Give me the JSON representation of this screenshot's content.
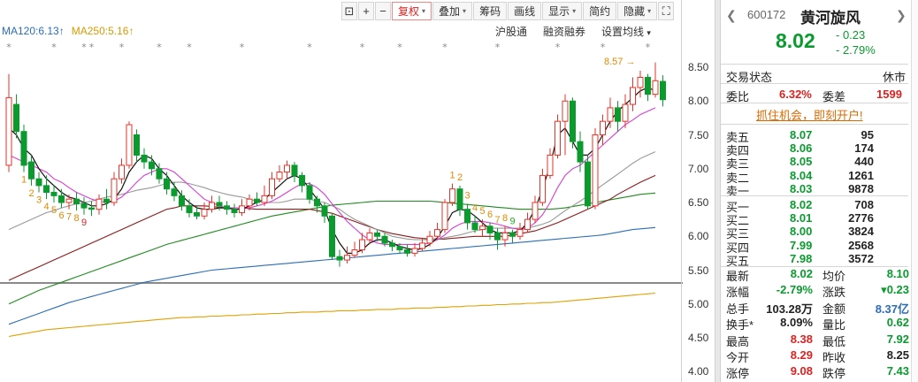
{
  "toolbar": {
    "icon_lock": "⊡",
    "icon_plus": "+",
    "icon_minus": "−",
    "fuquan": "复权",
    "diejia": "叠加",
    "chouma": "筹码",
    "huaxian": "画线",
    "xianshi": "显示",
    "jianyue": "简约",
    "yincang": "隐藏",
    "caret": "▾",
    "fullscreen_icon": "⛶"
  },
  "ma_legend": {
    "ma120": "MA120:6.13",
    "ma120_arrow": "↑",
    "ma250": "MA250:5.16",
    "ma250_arrow": "↑"
  },
  "sub_toolbar": {
    "hugutong": "沪股通",
    "rongzi": "融资融券",
    "shezhi": "设置均线",
    "caret": "▾"
  },
  "chart_data": {
    "type": "candlestick",
    "ylim": [
      4.0,
      8.5
    ],
    "y_ticks": [
      "8.50",
      "8.00",
      "7.50",
      "7.00",
      "6.50",
      "6.00",
      "5.50",
      "5.00",
      "4.50",
      "4.00"
    ],
    "high_label": "8.57",
    "high_arrow": "→",
    "candles": [
      {
        "o": 7.05,
        "c": 8.05,
        "h": 8.4,
        "l": 6.95
      },
      {
        "o": 7.95,
        "c": 7.55,
        "h": 8.1,
        "l": 7.45
      },
      {
        "o": 7.55,
        "c": 7.05,
        "h": 7.65,
        "l": 6.95
      },
      {
        "o": 7.1,
        "c": 6.85,
        "h": 7.2,
        "l": 6.75
      },
      {
        "o": 6.85,
        "c": 6.75,
        "h": 6.95,
        "l": 6.65
      },
      {
        "o": 6.75,
        "c": 6.65,
        "h": 6.9,
        "l": 6.55
      },
      {
        "o": 6.65,
        "c": 6.6,
        "h": 6.75,
        "l": 6.5
      },
      {
        "o": 6.6,
        "c": 6.5,
        "h": 6.7,
        "l": 6.42
      },
      {
        "o": 6.5,
        "c": 6.55,
        "h": 6.62,
        "l": 6.4
      },
      {
        "o": 6.55,
        "c": 6.48,
        "h": 6.65,
        "l": 6.38
      },
      {
        "o": 6.48,
        "c": 6.42,
        "h": 6.58,
        "l": 6.32
      },
      {
        "o": 6.42,
        "c": 6.4,
        "h": 6.52,
        "l": 6.3
      },
      {
        "o": 6.4,
        "c": 6.55,
        "h": 6.62,
        "l": 6.32
      },
      {
        "o": 6.55,
        "c": 6.5,
        "h": 6.7,
        "l": 6.4
      },
      {
        "o": 6.5,
        "c": 6.85,
        "h": 6.95,
        "l": 6.45
      },
      {
        "o": 6.85,
        "c": 7.05,
        "h": 7.15,
        "l": 6.78
      },
      {
        "o": 7.05,
        "c": 7.65,
        "h": 7.7,
        "l": 7.0
      },
      {
        "o": 7.5,
        "c": 7.2,
        "h": 7.58,
        "l": 7.1
      },
      {
        "o": 7.2,
        "c": 7.1,
        "h": 7.3,
        "l": 7.0
      },
      {
        "o": 7.1,
        "c": 7.0,
        "h": 7.2,
        "l": 6.9
      },
      {
        "o": 7.0,
        "c": 6.85,
        "h": 7.08,
        "l": 6.78
      },
      {
        "o": 6.85,
        "c": 6.7,
        "h": 6.95,
        "l": 6.62
      },
      {
        "o": 6.7,
        "c": 6.6,
        "h": 6.8,
        "l": 6.52
      },
      {
        "o": 6.6,
        "c": 6.45,
        "h": 6.68,
        "l": 6.38
      },
      {
        "o": 6.45,
        "c": 6.35,
        "h": 6.55,
        "l": 6.28
      },
      {
        "o": 6.35,
        "c": 6.3,
        "h": 6.45,
        "l": 6.25
      },
      {
        "o": 6.3,
        "c": 6.4,
        "h": 6.5,
        "l": 6.25
      },
      {
        "o": 6.4,
        "c": 6.5,
        "h": 6.6,
        "l": 6.35
      },
      {
        "o": 6.5,
        "c": 6.45,
        "h": 6.6,
        "l": 6.38
      },
      {
        "o": 6.45,
        "c": 6.4,
        "h": 6.52,
        "l": 6.32
      },
      {
        "o": 6.4,
        "c": 6.35,
        "h": 6.48,
        "l": 6.28
      },
      {
        "o": 6.35,
        "c": 6.45,
        "h": 6.55,
        "l": 6.3
      },
      {
        "o": 6.45,
        "c": 6.55,
        "h": 6.62,
        "l": 6.38
      },
      {
        "o": 6.55,
        "c": 6.5,
        "h": 6.65,
        "l": 6.45
      },
      {
        "o": 6.5,
        "c": 6.6,
        "h": 6.75,
        "l": 6.45
      },
      {
        "o": 6.6,
        "c": 6.85,
        "h": 6.95,
        "l": 6.55
      },
      {
        "o": 6.85,
        "c": 6.95,
        "h": 7.05,
        "l": 6.8
      },
      {
        "o": 6.95,
        "c": 7.05,
        "h": 7.12,
        "l": 6.85
      },
      {
        "o": 7.05,
        "c": 6.9,
        "h": 7.1,
        "l": 6.8
      },
      {
        "o": 6.9,
        "c": 6.75,
        "h": 6.95,
        "l": 6.65
      },
      {
        "o": 6.75,
        "c": 6.55,
        "h": 6.8,
        "l": 6.48
      },
      {
        "o": 6.55,
        "c": 6.45,
        "h": 6.6,
        "l": 6.35
      },
      {
        "o": 6.45,
        "c": 6.3,
        "h": 6.5,
        "l": 6.2
      },
      {
        "o": 6.3,
        "c": 5.7,
        "h": 6.35,
        "l": 5.65
      },
      {
        "o": 5.7,
        "c": 5.65,
        "h": 5.8,
        "l": 5.55
      },
      {
        "o": 5.65,
        "c": 5.72,
        "h": 5.85,
        "l": 5.6
      },
      {
        "o": 5.72,
        "c": 5.8,
        "h": 5.92,
        "l": 5.68
      },
      {
        "o": 5.8,
        "c": 5.95,
        "h": 6.05,
        "l": 5.75
      },
      {
        "o": 5.95,
        "c": 6.05,
        "h": 6.12,
        "l": 5.88
      },
      {
        "o": 6.05,
        "c": 6.0,
        "h": 6.1,
        "l": 5.92
      },
      {
        "o": 6.0,
        "c": 5.9,
        "h": 6.05,
        "l": 5.85
      },
      {
        "o": 5.9,
        "c": 5.85,
        "h": 5.95,
        "l": 5.78
      },
      {
        "o": 5.85,
        "c": 5.8,
        "h": 5.9,
        "l": 5.75
      },
      {
        "o": 5.8,
        "c": 5.75,
        "h": 5.88,
        "l": 5.7
      },
      {
        "o": 5.75,
        "c": 5.82,
        "h": 5.9,
        "l": 5.7
      },
      {
        "o": 5.82,
        "c": 5.9,
        "h": 5.98,
        "l": 5.78
      },
      {
        "o": 5.9,
        "c": 6.0,
        "h": 6.08,
        "l": 5.85
      },
      {
        "o": 6.0,
        "c": 6.1,
        "h": 6.2,
        "l": 5.95
      },
      {
        "o": 6.1,
        "c": 6.5,
        "h": 6.55,
        "l": 6.05
      },
      {
        "o": 6.5,
        "c": 6.7,
        "h": 6.78,
        "l": 6.45
      },
      {
        "o": 6.7,
        "c": 6.4,
        "h": 6.75,
        "l": 6.3
      },
      {
        "o": 6.4,
        "c": 6.2,
        "h": 6.48,
        "l": 6.1
      },
      {
        "o": 6.2,
        "c": 6.1,
        "h": 6.3,
        "l": 6.05
      },
      {
        "o": 6.1,
        "c": 6.15,
        "h": 6.25,
        "l": 6.0
      },
      {
        "o": 6.15,
        "c": 6.05,
        "h": 6.2,
        "l": 5.95
      },
      {
        "o": 6.05,
        "c": 5.95,
        "h": 6.12,
        "l": 5.8
      },
      {
        "o": 5.95,
        "c": 6.05,
        "h": 6.15,
        "l": 5.85
      },
      {
        "o": 6.05,
        "c": 6.0,
        "h": 6.1,
        "l": 5.9
      },
      {
        "o": 6.0,
        "c": 6.1,
        "h": 6.2,
        "l": 5.95
      },
      {
        "o": 6.1,
        "c": 6.25,
        "h": 6.35,
        "l": 6.05
      },
      {
        "o": 6.25,
        "c": 6.5,
        "h": 6.6,
        "l": 6.2
      },
      {
        "o": 6.5,
        "c": 6.9,
        "h": 7.0,
        "l": 6.45
      },
      {
        "o": 6.9,
        "c": 7.2,
        "h": 7.3,
        "l": 6.85
      },
      {
        "o": 7.2,
        "c": 7.7,
        "h": 7.8,
        "l": 7.15
      },
      {
        "o": 7.7,
        "c": 8.0,
        "h": 8.1,
        "l": 7.2
      },
      {
        "o": 8.0,
        "c": 7.4,
        "h": 8.05,
        "l": 7.3
      },
      {
        "o": 7.4,
        "c": 7.1,
        "h": 7.55,
        "l": 6.95
      },
      {
        "o": 7.1,
        "c": 6.45,
        "h": 7.2,
        "l": 6.4
      },
      {
        "o": 6.45,
        "c": 7.5,
        "h": 7.6,
        "l": 6.4
      },
      {
        "o": 7.5,
        "c": 7.7,
        "h": 7.8,
        "l": 7.35
      },
      {
        "o": 7.7,
        "c": 7.9,
        "h": 8.05,
        "l": 7.6
      },
      {
        "o": 7.9,
        "c": 7.7,
        "h": 8.0,
        "l": 7.55
      },
      {
        "o": 7.7,
        "c": 7.95,
        "h": 8.1,
        "l": 7.6
      },
      {
        "o": 7.95,
        "c": 8.2,
        "h": 8.35,
        "l": 7.85
      },
      {
        "o": 8.2,
        "c": 8.35,
        "h": 8.45,
        "l": 8.05
      },
      {
        "o": 8.35,
        "c": 8.1,
        "h": 8.4,
        "l": 8.0
      },
      {
        "o": 8.1,
        "c": 8.3,
        "h": 8.57,
        "l": 8.05
      },
      {
        "o": 8.29,
        "c": 8.02,
        "h": 8.38,
        "l": 7.92
      }
    ],
    "ma5": [
      7.6,
      7.5,
      7.3,
      7.2,
      7.0,
      6.85,
      6.75,
      6.65,
      6.58,
      6.55,
      6.5,
      6.45,
      6.45,
      6.48,
      6.55,
      6.7,
      6.95,
      7.1,
      7.2,
      7.15,
      7.0,
      6.9,
      6.75,
      6.6,
      6.5,
      6.42,
      6.4,
      6.4,
      6.42,
      6.42,
      6.4,
      6.4,
      6.45,
      6.5,
      6.55,
      6.65,
      6.75,
      6.85,
      6.9,
      6.85,
      6.7,
      6.55,
      6.4,
      6.1,
      5.9,
      5.75,
      5.75,
      5.8,
      5.9,
      5.95,
      5.95,
      5.9,
      5.85,
      5.82,
      5.8,
      5.82,
      5.88,
      5.98,
      6.15,
      6.35,
      6.4,
      6.38,
      6.3,
      6.2,
      6.1,
      6.05,
      6.05,
      6.05,
      6.08,
      6.2,
      6.4,
      6.7,
      7.05,
      7.5,
      7.6,
      7.4,
      7.2,
      7.2,
      7.3,
      7.5,
      7.7,
      7.85,
      7.95,
      8.05,
      8.15,
      8.2,
      8.15
    ],
    "ma10": [
      7.2,
      7.15,
      7.1,
      7.05,
      7.0,
      6.95,
      6.85,
      6.8,
      6.72,
      6.65,
      6.6,
      6.55,
      6.52,
      6.5,
      6.52,
      6.58,
      6.68,
      6.8,
      6.9,
      6.95,
      7.0,
      7.0,
      6.95,
      6.85,
      6.75,
      6.65,
      6.55,
      6.5,
      6.45,
      6.42,
      6.42,
      6.42,
      6.42,
      6.45,
      6.48,
      6.52,
      6.58,
      6.65,
      6.72,
      6.78,
      6.78,
      6.72,
      6.62,
      6.48,
      6.35,
      6.22,
      6.12,
      6.02,
      5.95,
      5.9,
      5.88,
      5.88,
      5.88,
      5.88,
      5.88,
      5.88,
      5.9,
      5.95,
      6.02,
      6.12,
      6.18,
      6.22,
      6.22,
      6.22,
      6.2,
      6.18,
      6.15,
      6.12,
      6.1,
      6.12,
      6.2,
      6.32,
      6.5,
      6.72,
      6.9,
      7.0,
      7.05,
      7.15,
      7.25,
      7.35,
      7.45,
      7.55,
      7.65,
      7.72,
      7.8,
      7.85,
      7.9
    ],
    "ma20": [
      6.1,
      6.15,
      6.2,
      6.25,
      6.3,
      6.35,
      6.38,
      6.42,
      6.45,
      6.48,
      6.5,
      6.52,
      6.55,
      6.58,
      6.6,
      6.62,
      6.65,
      6.68,
      6.7,
      6.72,
      6.75,
      6.78,
      6.8,
      6.8,
      6.78,
      6.75,
      6.72,
      6.68,
      6.65,
      6.62,
      6.6,
      6.58,
      6.55,
      6.52,
      6.5,
      6.5,
      6.5,
      6.52,
      6.55,
      6.55,
      6.55,
      6.52,
      6.5,
      6.45,
      6.4,
      6.32,
      6.25,
      6.2,
      6.15,
      6.1,
      6.05,
      6.0,
      5.98,
      5.96,
      5.95,
      5.95,
      5.95,
      5.96,
      5.98,
      6.0,
      6.02,
      6.05,
      6.08,
      6.1,
      6.12,
      6.12,
      6.12,
      6.12,
      6.12,
      6.12,
      6.15,
      6.18,
      6.22,
      6.3,
      6.38,
      6.45,
      6.52,
      6.6,
      6.68,
      6.76,
      6.84,
      6.92,
      7.0,
      7.08,
      7.15,
      7.2,
      7.25
    ],
    "ma30": [
      5.35,
      5.4,
      5.45,
      5.5,
      5.55,
      5.6,
      5.65,
      5.7,
      5.75,
      5.8,
      5.85,
      5.9,
      5.95,
      6.0,
      6.05,
      6.1,
      6.15,
      6.2,
      6.25,
      6.3,
      6.35,
      6.4,
      6.42,
      6.45,
      6.45,
      6.45,
      6.45,
      6.44,
      6.43,
      6.42,
      6.42,
      6.42,
      6.41,
      6.4,
      6.4,
      6.4,
      6.4,
      6.4,
      6.4,
      6.4,
      6.4,
      6.38,
      6.36,
      6.34,
      6.3,
      6.26,
      6.22,
      6.18,
      6.14,
      6.1,
      6.07,
      6.04,
      6.02,
      6.0,
      5.98,
      5.97,
      5.96,
      5.96,
      5.96,
      5.97,
      5.98,
      5.99,
      6.0,
      6.0,
      6.0,
      6.0,
      6.0,
      6.02,
      6.04,
      6.06,
      6.08,
      6.12,
      6.16,
      6.2,
      6.25,
      6.3,
      6.35,
      6.4,
      6.45,
      6.5,
      6.55,
      6.62,
      6.68,
      6.74,
      6.8,
      6.85,
      6.9
    ],
    "ma60": [
      5.0,
      5.05,
      5.1,
      5.15,
      5.2,
      5.24,
      5.28,
      5.32,
      5.36,
      5.4,
      5.44,
      5.48,
      5.52,
      5.56,
      5.6,
      5.64,
      5.68,
      5.72,
      5.76,
      5.8,
      5.84,
      5.88,
      5.91,
      5.94,
      5.97,
      6.0,
      6.03,
      6.06,
      6.09,
      6.12,
      6.15,
      6.18,
      6.21,
      6.24,
      6.27,
      6.3,
      6.32,
      6.34,
      6.36,
      6.38,
      6.4,
      6.42,
      6.44,
      6.46,
      6.47,
      6.48,
      6.49,
      6.5,
      6.51,
      6.52,
      6.52,
      6.52,
      6.52,
      6.52,
      6.52,
      6.52,
      6.52,
      6.51,
      6.5,
      6.49,
      6.48,
      6.47,
      6.46,
      6.45,
      6.44,
      6.43,
      6.42,
      6.41,
      6.4,
      6.4,
      6.4,
      6.4,
      6.4,
      6.41,
      6.42,
      6.44,
      6.46,
      6.48,
      6.5,
      6.52,
      6.54,
      6.56,
      6.58,
      6.6,
      6.62,
      6.63,
      6.64
    ],
    "ma120": [
      4.7,
      4.74,
      4.78,
      4.82,
      4.86,
      4.9,
      4.94,
      4.98,
      5.02,
      5.05,
      5.08,
      5.11,
      5.14,
      5.17,
      5.2,
      5.23,
      5.26,
      5.29,
      5.32,
      5.34,
      5.36,
      5.38,
      5.4,
      5.42,
      5.44,
      5.46,
      5.48,
      5.5,
      5.51,
      5.52,
      5.53,
      5.54,
      5.55,
      5.56,
      5.57,
      5.58,
      5.59,
      5.6,
      5.61,
      5.62,
      5.63,
      5.64,
      5.65,
      5.66,
      5.67,
      5.68,
      5.69,
      5.7,
      5.71,
      5.72,
      5.73,
      5.74,
      5.75,
      5.76,
      5.77,
      5.78,
      5.79,
      5.8,
      5.81,
      5.82,
      5.83,
      5.84,
      5.85,
      5.86,
      5.87,
      5.88,
      5.89,
      5.9,
      5.91,
      5.92,
      5.93,
      5.94,
      5.95,
      5.96,
      5.97,
      5.98,
      5.99,
      6.0,
      6.01,
      6.02,
      6.04,
      6.06,
      6.08,
      6.1,
      6.11,
      6.12,
      6.13
    ],
    "ma250": [
      4.52,
      4.54,
      4.56,
      4.58,
      4.6,
      4.62,
      4.63,
      4.64,
      4.65,
      4.66,
      4.67,
      4.68,
      4.69,
      4.7,
      4.71,
      4.72,
      4.73,
      4.74,
      4.75,
      4.76,
      4.77,
      4.78,
      4.79,
      4.8,
      4.8,
      4.81,
      4.81,
      4.82,
      4.82,
      4.83,
      4.83,
      4.84,
      4.84,
      4.85,
      4.85,
      4.86,
      4.86,
      4.87,
      4.87,
      4.88,
      4.88,
      4.88,
      4.89,
      4.89,
      4.9,
      4.9,
      4.9,
      4.91,
      4.91,
      4.92,
      4.92,
      4.92,
      4.93,
      4.93,
      4.94,
      4.94,
      4.94,
      4.95,
      4.95,
      4.96,
      4.96,
      4.97,
      4.97,
      4.98,
      4.98,
      4.99,
      4.99,
      5.0,
      5.0,
      5.01,
      5.01,
      5.02,
      5.02,
      5.03,
      5.04,
      5.05,
      5.06,
      5.07,
      5.08,
      5.09,
      5.1,
      5.11,
      5.12,
      5.13,
      5.14,
      5.15,
      5.16
    ],
    "td_labels": [
      {
        "i": 2,
        "t": "1"
      },
      {
        "i": 3,
        "t": "2"
      },
      {
        "i": 4,
        "t": "3"
      },
      {
        "i": 5,
        "t": "4"
      },
      {
        "i": 6,
        "t": "5"
      },
      {
        "i": 7,
        "t": "6"
      },
      {
        "i": 8,
        "t": "7"
      },
      {
        "i": 9,
        "t": "8"
      },
      {
        "i": 10,
        "t": "9"
      },
      {
        "i": 59,
        "t": "1"
      },
      {
        "i": 60,
        "t": "2"
      },
      {
        "i": 61,
        "t": "3"
      },
      {
        "i": 62,
        "t": "4"
      },
      {
        "i": 63,
        "t": "5"
      },
      {
        "i": 64,
        "t": "6"
      },
      {
        "i": 65,
        "t": "7"
      },
      {
        "i": 66,
        "t": "8"
      },
      {
        "i": 67,
        "t": "9"
      }
    ],
    "stars": [
      0,
      6,
      10,
      11,
      15,
      20,
      24,
      31,
      40,
      47,
      52,
      58,
      65,
      73,
      79,
      85
    ]
  },
  "quote": {
    "prev_icon": "❮",
    "next_icon": "❯",
    "code": "600172",
    "name": "黄河旋风",
    "price": "8.02",
    "change": "- 0.23",
    "change_pct": "- 2.79%",
    "state_label": "交易状态",
    "state_value": "休市",
    "weibi_label": "委比",
    "weibi_value": "6.32%",
    "weicha_label": "委差",
    "weicha_value": "1599",
    "promo": "抓住机会，即刻开户!",
    "sell": [
      {
        "label": "卖五",
        "price": "8.07",
        "vol": "95"
      },
      {
        "label": "卖四",
        "price": "8.06",
        "vol": "174"
      },
      {
        "label": "卖三",
        "price": "8.05",
        "vol": "440"
      },
      {
        "label": "卖二",
        "price": "8.04",
        "vol": "1261"
      },
      {
        "label": "卖一",
        "price": "8.03",
        "vol": "9878"
      }
    ],
    "buy": [
      {
        "label": "买一",
        "price": "8.02",
        "vol": "708"
      },
      {
        "label": "买二",
        "price": "8.01",
        "vol": "2776"
      },
      {
        "label": "买三",
        "price": "8.00",
        "vol": "3824"
      },
      {
        "label": "买四",
        "price": "7.99",
        "vol": "2568"
      },
      {
        "label": "买五",
        "price": "7.98",
        "vol": "3572"
      }
    ],
    "stats": [
      {
        "l1": "最新",
        "v1": "8.02",
        "c1": "green",
        "l2": "均价",
        "v2": "8.10",
        "c2": "green"
      },
      {
        "l1": "涨幅",
        "v1": "-2.79%",
        "c1": "green",
        "l2": "涨跌",
        "v2": "▾0.23",
        "c2": "green"
      },
      {
        "l1": "总手",
        "v1": "103.28万",
        "c1": "dark",
        "l2": "金额",
        "v2": "8.37亿",
        "c2": "blue"
      },
      {
        "l1": "换手*",
        "v1": "8.09%",
        "c1": "dark",
        "l2": "量比",
        "v2": "0.62",
        "c2": "green"
      },
      {
        "l1": "最高",
        "v1": "8.38",
        "c1": "red",
        "l2": "最低",
        "v2": "7.92",
        "c2": "green"
      },
      {
        "l1": "今开",
        "v1": "8.29",
        "c1": "red",
        "l2": "昨收",
        "v2": "8.25",
        "c2": "dark"
      },
      {
        "l1": "涨停",
        "v1": "9.08",
        "c1": "red",
        "l2": "跌停",
        "v2": "7.43",
        "c2": "green"
      }
    ]
  },
  "colors": {
    "up": "#e5332a",
    "down": "#0a9a2e",
    "ma5": "#111111",
    "ma10": "#d63fd6",
    "ma20": "#999999",
    "ma30": "#8b1a1a",
    "ma60": "#1f8a1f",
    "ma120": "#2a6db8",
    "ma250": "#e0a000",
    "td_orange": "#e08a00",
    "td_green": "#22aa22",
    "td_red": "#d22"
  }
}
